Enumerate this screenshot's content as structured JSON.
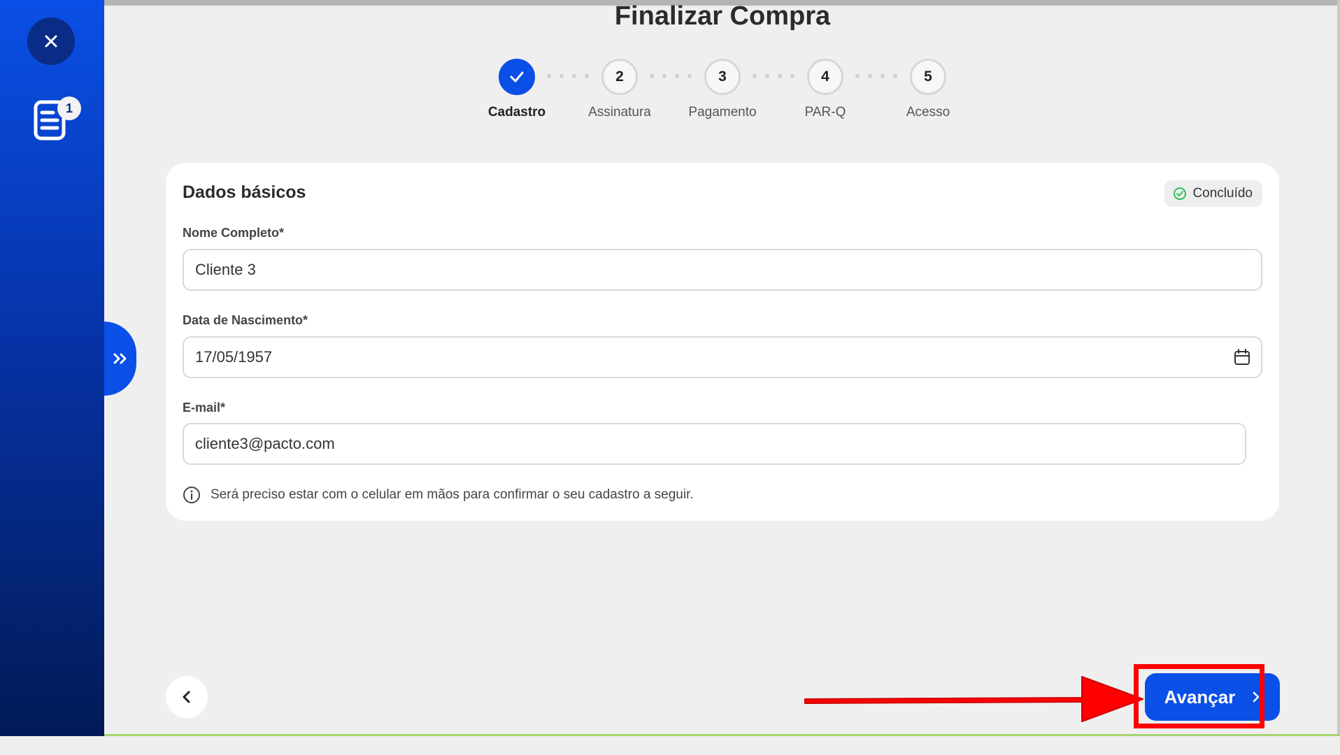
{
  "sidebar": {
    "close_icon": "close-icon",
    "doc_icon": "document-icon",
    "doc_badge": "1",
    "expand_icon": "double-chevron-right-icon"
  },
  "page": {
    "title": "Finalizar Compra"
  },
  "stepper": {
    "steps": [
      {
        "number": "",
        "label": "Cadastro",
        "state": "done"
      },
      {
        "number": "2",
        "label": "Assinatura",
        "state": "pending"
      },
      {
        "number": "3",
        "label": "Pagamento",
        "state": "pending"
      },
      {
        "number": "4",
        "label": "PAR-Q",
        "state": "pending"
      },
      {
        "number": "5",
        "label": "Acesso",
        "state": "pending"
      }
    ]
  },
  "card": {
    "title": "Dados básicos",
    "status": "Concluído",
    "fields": {
      "name_label": "Nome Completo*",
      "name_value": "Cliente 3",
      "birth_label": "Data de Nascimento*",
      "birth_value": "17/05/1957",
      "email_label": "E-mail*",
      "email_value": "cliente3@pacto.com"
    },
    "info": "Será preciso estar com o celular em mãos para confirmar o seu cadastro a seguir."
  },
  "footer": {
    "next_label": "Avançar"
  },
  "colors": {
    "accent": "#0a4fe6",
    "success": "#2ebd59",
    "annotation": "#ff0000"
  }
}
